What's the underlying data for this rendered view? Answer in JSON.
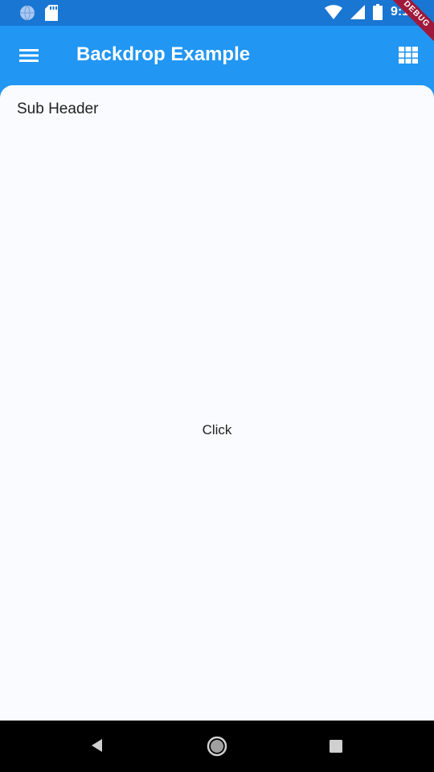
{
  "status_bar": {
    "time": "9:15",
    "icons": [
      "globe-icon",
      "sd-card-icon",
      "wifi-icon",
      "signal-icon",
      "battery-icon"
    ]
  },
  "app_bar": {
    "title": "Backdrop Example",
    "menu_icon": "hamburger-menu-icon",
    "action_icon": "grid-view-icon",
    "color": "#2196F3"
  },
  "debug_banner": "DEBUG",
  "front_layer": {
    "sub_header": "Sub Header",
    "button_label": "Click"
  },
  "nav_bar": {
    "icons": [
      "back-icon",
      "home-icon",
      "recents-icon"
    ]
  }
}
